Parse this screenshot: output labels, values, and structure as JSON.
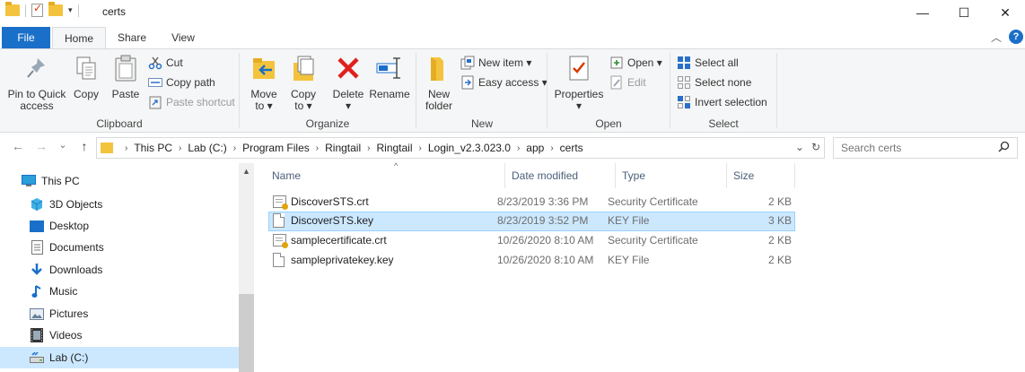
{
  "window": {
    "title": "certs",
    "qat_dropdown": "▾",
    "minimize": "—",
    "maximize": "☐",
    "close": "✕"
  },
  "tabs": [
    {
      "label": "File"
    },
    {
      "label": "Home"
    },
    {
      "label": "Share"
    },
    {
      "label": "View"
    }
  ],
  "tab_right": {
    "collapse": "︿",
    "help": "?"
  },
  "ribbon": {
    "clipboard": {
      "label": "Clipboard",
      "pin": "Pin to Quick\naccess",
      "copy": "Copy",
      "paste": "Paste",
      "cut": "Cut",
      "copy_path": "Copy path",
      "paste_shortcut": "Paste shortcut"
    },
    "organize": {
      "label": "Organize",
      "move_to": "Move\nto ▾",
      "copy_to": "Copy\nto ▾",
      "delete": "Delete\n▾",
      "rename": "Rename"
    },
    "new": {
      "label": "New",
      "new_folder": "New\nfolder",
      "new_item": "New item ▾",
      "easy_access": "Easy access ▾"
    },
    "open": {
      "label": "Open",
      "properties": "Properties\n▾",
      "open": "Open ▾",
      "edit": "Edit"
    },
    "select": {
      "label": "Select",
      "select_all": "Select all",
      "select_none": "Select none",
      "invert": "Invert selection"
    }
  },
  "address": {
    "back": "←",
    "forward": "→",
    "recent": "⌄",
    "up": "↑",
    "crumbs": [
      "This PC",
      "Lab (C:)",
      "Program Files",
      "Ringtail",
      "Ringtail",
      "Login_v2.3.023.0",
      "app",
      "certs"
    ],
    "dropdown": "⌄",
    "refresh": "↻"
  },
  "search": {
    "placeholder": "Search certs"
  },
  "navpane": {
    "items": [
      {
        "label": "This PC",
        "icon": "pc-icon"
      },
      {
        "label": "3D Objects",
        "icon": "3d-objects-icon"
      },
      {
        "label": "Desktop",
        "icon": "desktop-icon"
      },
      {
        "label": "Documents",
        "icon": "documents-icon"
      },
      {
        "label": "Downloads",
        "icon": "downloads-icon"
      },
      {
        "label": "Music",
        "icon": "music-icon"
      },
      {
        "label": "Pictures",
        "icon": "pictures-icon"
      },
      {
        "label": "Videos",
        "icon": "videos-icon"
      },
      {
        "label": "Lab (C:)",
        "icon": "drive-icon"
      }
    ],
    "scroll_up": "▲"
  },
  "filelist": {
    "columns": {
      "name": "Name",
      "date": "Date modified",
      "type": "Type",
      "size": "Size",
      "sort": "^"
    },
    "rows": [
      {
        "name": "DiscoverSTS.crt",
        "date": "8/23/2019 3:36 PM",
        "type": "Security Certificate",
        "size": "2 KB",
        "icon": "certificate-icon"
      },
      {
        "name": "DiscoverSTS.key",
        "date": "8/23/2019 3:52 PM",
        "type": "KEY File",
        "size": "3 KB",
        "icon": "file-icon"
      },
      {
        "name": "samplecertificate.crt",
        "date": "10/26/2020 8:10 AM",
        "type": "Security Certificate",
        "size": "2 KB",
        "icon": "certificate-icon"
      },
      {
        "name": "sampleprivatekey.key",
        "date": "10/26/2020 8:10 AM",
        "type": "KEY File",
        "size": "2 KB",
        "icon": "file-icon"
      }
    ]
  }
}
